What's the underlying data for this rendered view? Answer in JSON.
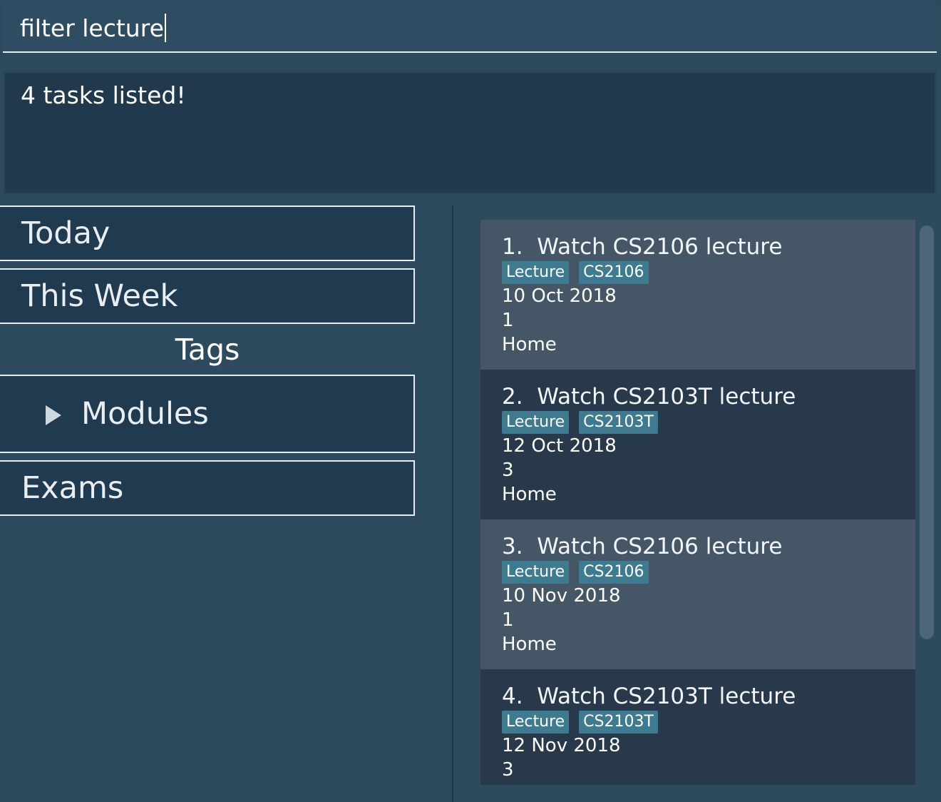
{
  "command": {
    "value": "filter lecture"
  },
  "result": {
    "message": "4 tasks listed!"
  },
  "nav": {
    "today": "Today",
    "this_week": "This Week",
    "tags_heading": "Tags",
    "modules": "Modules",
    "exams": "Exams"
  },
  "tasks": [
    {
      "index": "1.",
      "title": "Watch CS2106 lecture",
      "tags": [
        "Lecture",
        "CS2106"
      ],
      "date": "10 Oct 2018",
      "priority": "1",
      "location": "Home"
    },
    {
      "index": "2.",
      "title": "Watch CS2103T lecture",
      "tags": [
        "Lecture",
        "CS2103T"
      ],
      "date": "12 Oct 2018",
      "priority": "3",
      "location": "Home"
    },
    {
      "index": "3.",
      "title": "Watch CS2106 lecture",
      "tags": [
        "Lecture",
        "CS2106"
      ],
      "date": "10 Nov 2018",
      "priority": "1",
      "location": "Home"
    },
    {
      "index": "4.",
      "title": "Watch CS2103T lecture",
      "tags": [
        "Lecture",
        "CS2103T"
      ],
      "date": "12 Nov 2018",
      "priority": "3",
      "location": ""
    }
  ],
  "colors": {
    "background": "#2d4a5f",
    "panel": "#203a4f",
    "card_light": "#455767",
    "card_dark": "#27394a",
    "tag": "#3e7b91"
  }
}
